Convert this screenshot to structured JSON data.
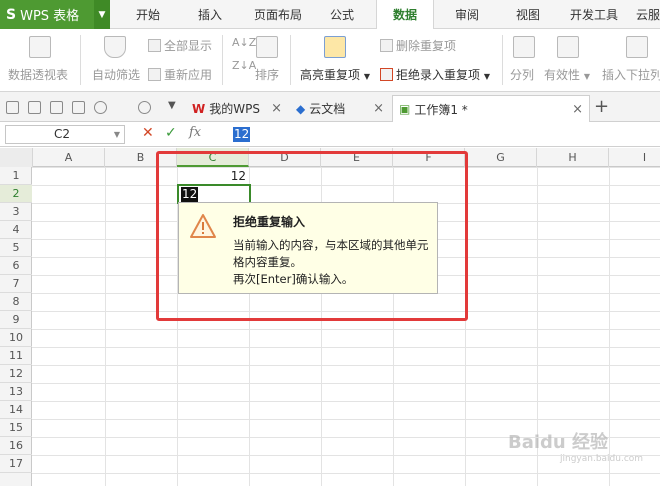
{
  "app": {
    "logo": "S",
    "title": "WPS 表格",
    "accent": "#4e9a32"
  },
  "menu": {
    "tabs": [
      "开始",
      "插入",
      "页面布局",
      "公式",
      "数据",
      "审阅",
      "视图",
      "开发工具",
      "云服"
    ],
    "active": "数据"
  },
  "ribbon": {
    "pivot": "数据透视表",
    "autofilter": "自动筛选",
    "show_all": "全部显示",
    "reapply": "重新应用",
    "sort": "排序",
    "highlight_dup": "高亮重复项",
    "remove_dup": "删除重复项",
    "reject_dup": "拒绝录入重复项",
    "split": "分列",
    "validity": "有效性",
    "insert_dropdown": "插入下拉列"
  },
  "doc_tabs": [
    {
      "label": "我的WPS"
    },
    {
      "label": "云文档"
    },
    {
      "label": "工作簿1 *"
    }
  ],
  "formula_bar": {
    "cell_ref": "C2",
    "fx": "fx",
    "value": "12"
  },
  "grid": {
    "columns": [
      "A",
      "B",
      "C",
      "D",
      "E",
      "F",
      "G",
      "H",
      "I"
    ],
    "rows": [
      "1",
      "2",
      "3",
      "4",
      "5",
      "6",
      "7",
      "8",
      "9",
      "10",
      "11",
      "12",
      "13",
      "14",
      "15",
      "16",
      "17"
    ],
    "selected_column": "C",
    "selected_row": "2",
    "cells": {
      "C1": "12",
      "C2": "12"
    }
  },
  "tooltip": {
    "title": "拒绝重复输入",
    "line1": "当前输入的内容，与本区域的其他单元",
    "line2": "格内容重复。",
    "line3": "再次[Enter]确认输入。"
  },
  "watermark": {
    "text": "Baidu 经验",
    "sub": "jingyan.baidu.com"
  },
  "colors": {
    "highlight_box": "#e23a3a",
    "selection_green": "#3a8a2a",
    "tooltip_bg": "#ffffe6"
  }
}
